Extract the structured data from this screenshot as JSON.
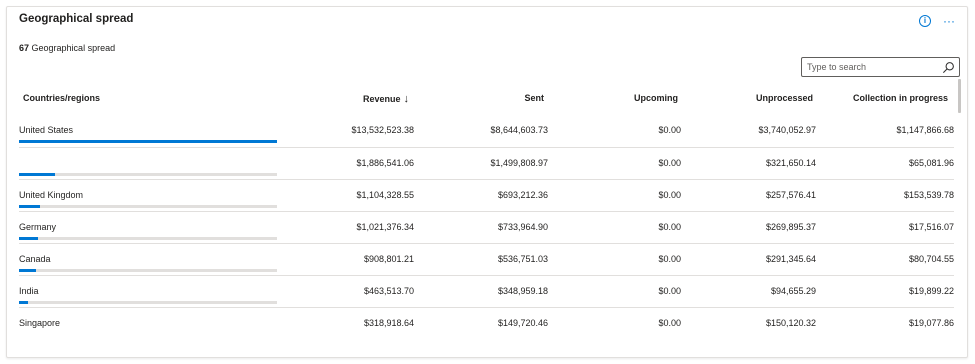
{
  "card": {
    "title": "Geographical spread",
    "summary_count": "67",
    "summary_label": "Geographical spread"
  },
  "actions": {
    "info_icon": "info-icon",
    "more_icon": "more-icon"
  },
  "search": {
    "placeholder": "Type to search",
    "value": ""
  },
  "colors": {
    "accent": "#0078d4",
    "track": "#e1dfdd"
  },
  "table": {
    "headers": {
      "country": "Countries/regions",
      "revenue": "Revenue",
      "revenue_sort": "↓",
      "sent": "Sent",
      "upcoming": "Upcoming",
      "unprocessed": "Unprocessed",
      "collection": "Collection in progress"
    },
    "rows": [
      {
        "country": "United States",
        "revenue": "$13,532,523.38",
        "sent": "$8,644,603.73",
        "upcoming": "$0.00",
        "unprocessed": "$3,740,052.97",
        "collection": "$1,147,866.68",
        "share": 1.0
      },
      {
        "country": "",
        "revenue": "$1,886,541.06",
        "sent": "$1,499,808.97",
        "upcoming": "$0.00",
        "unprocessed": "$321,650.14",
        "collection": "$65,081.96",
        "share": 0.139
      },
      {
        "country": "United Kingdom",
        "revenue": "$1,104,328.55",
        "sent": "$693,212.36",
        "upcoming": "$0.00",
        "unprocessed": "$257,576.41",
        "collection": "$153,539.78",
        "share": 0.082
      },
      {
        "country": "Germany",
        "revenue": "$1,021,376.34",
        "sent": "$733,964.90",
        "upcoming": "$0.00",
        "unprocessed": "$269,895.37",
        "collection": "$17,516.07",
        "share": 0.075
      },
      {
        "country": "Canada",
        "revenue": "$908,801.21",
        "sent": "$536,751.03",
        "upcoming": "$0.00",
        "unprocessed": "$291,345.64",
        "collection": "$80,704.55",
        "share": 0.067
      },
      {
        "country": "India",
        "revenue": "$463,513.70",
        "sent": "$348,959.18",
        "upcoming": "$0.00",
        "unprocessed": "$94,655.29",
        "collection": "$19,899.22",
        "share": 0.034
      },
      {
        "country": "Singapore",
        "revenue": "$318,918.64",
        "sent": "$149,720.46",
        "upcoming": "$0.00",
        "unprocessed": "$150,120.32",
        "collection": "$19,077.86",
        "share": null
      }
    ]
  }
}
